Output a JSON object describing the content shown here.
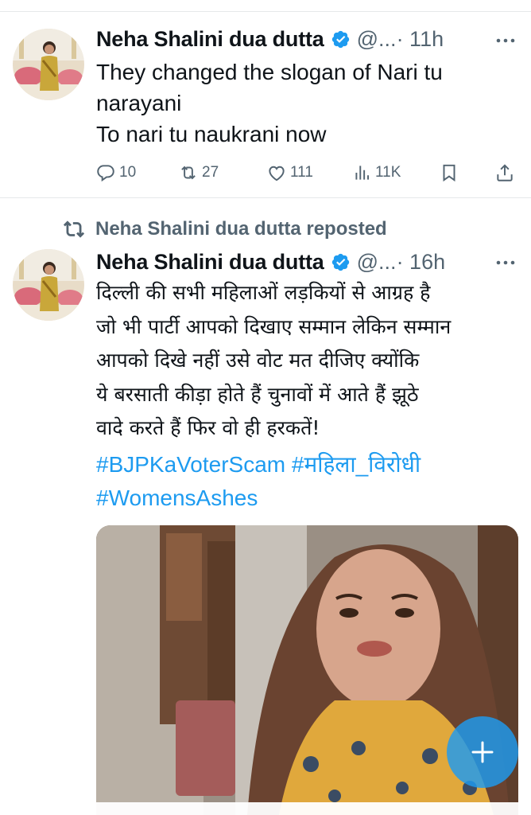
{
  "colors": {
    "accent": "#1d9bf0",
    "secondary_text": "#536471",
    "primary_text": "#0f1419",
    "divider": "#e6e9ea"
  },
  "tweet1": {
    "author_name": "Neha Shalini dua dutta",
    "handle": "@...",
    "time": "· 11h",
    "text": "They changed the  slogan  of  Nari tu narayani\nTo nari tu  naukrani  now",
    "actions": {
      "replies": "10",
      "reposts": "27",
      "likes": "111",
      "views": "11K"
    },
    "icons": {
      "reply": "reply-icon",
      "repost": "repost-icon",
      "like": "heart-icon",
      "views": "views-icon",
      "bookmark": "bookmark-icon",
      "share": "share-icon",
      "more": "more-icon",
      "verified": "verified-icon"
    }
  },
  "tweet2": {
    "repost_label": "Neha Shalini dua dutta reposted",
    "author_name": "Neha Shalini dua dutta",
    "handle": "@...",
    "time": "· 16h",
    "text_lines": [
      "दिल्ली की सभी  महिलाओं  लड़कियों से आग्रह है",
      "जो  भी  पार्टी आपको दिखाए सम्मान लेकिन सम्मान",
      "आपको  दिखे नहीं  उसे  वोट  मत दीजिए  क्योंकि",
      "ये  बरसाती कीड़ा होते हैं  चुनावों में  आते हैं  झूठे",
      "वादे  करते हैं  फिर  वो ही  हरकतें!"
    ],
    "hashtags": [
      "#BJPKaVoterScam",
      "#महिला_विरोधी",
      "#WomensAshes"
    ],
    "media": "video-frame"
  },
  "fab": {
    "icon": "plus-icon"
  }
}
